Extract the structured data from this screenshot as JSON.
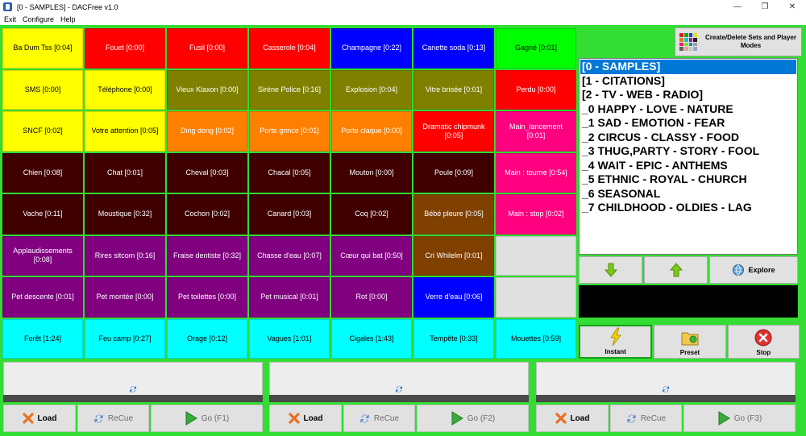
{
  "window": {
    "title": "[0 - SAMPLES] - DACFree v1.0",
    "minimize": "—",
    "maximize": "❐",
    "close": "✕"
  },
  "menu": [
    "Exit",
    "Configure",
    "Help"
  ],
  "colors": {
    "frame": "#33dd33",
    "selected": "#0078d7"
  },
  "pads": [
    [
      {
        "label": "Ba Dum Tss [0:04]",
        "bg": "#ffff00",
        "fg": "#000000"
      },
      {
        "label": "Fouet [0:00]",
        "bg": "#ff0000",
        "fg": "#ffffff"
      },
      {
        "label": "Fusil [0:00]",
        "bg": "#ff0000",
        "fg": "#ffffff"
      },
      {
        "label": "Casserole [0:04]",
        "bg": "#ff0000",
        "fg": "#ffffff"
      },
      {
        "label": "Champagne [0:22]",
        "bg": "#0000ff",
        "fg": "#ffffff"
      },
      {
        "label": "Canette soda [0:13]",
        "bg": "#0000ff",
        "fg": "#ffffff"
      },
      {
        "label": "Gagné [0:01]",
        "bg": "#00ff00",
        "fg": "#000000"
      }
    ],
    [
      {
        "label": "SMS [0:00]",
        "bg": "#ffff00",
        "fg": "#000000"
      },
      {
        "label": "Téléphone [0:00]",
        "bg": "#ffff00",
        "fg": "#000000"
      },
      {
        "label": "Vieux Klaxon [0:00]",
        "bg": "#808000",
        "fg": "#ffffff"
      },
      {
        "label": "Sirène Police [0:16]",
        "bg": "#808000",
        "fg": "#ffffff"
      },
      {
        "label": "Explosion [0:04]",
        "bg": "#808000",
        "fg": "#ffffff"
      },
      {
        "label": "Vitre brisée [0:01]",
        "bg": "#808000",
        "fg": "#ffffff"
      },
      {
        "label": "Perdu [0:00]",
        "bg": "#ff0000",
        "fg": "#ffffff"
      }
    ],
    [
      {
        "label": "SNCF [0:02]",
        "bg": "#ffff00",
        "fg": "#000000"
      },
      {
        "label": "Votre attention [0:05]",
        "bg": "#ffff00",
        "fg": "#000000"
      },
      {
        "label": "Ding dong [0:02]",
        "bg": "#ff8000",
        "fg": "#ffffff"
      },
      {
        "label": "Porte grince [0:01]",
        "bg": "#ff8000",
        "fg": "#ffffff"
      },
      {
        "label": "Porte claque [0:00]",
        "bg": "#ff8000",
        "fg": "#ffffff"
      },
      {
        "label": "Dramatic chipmunk [0:05]",
        "bg": "#ff0000",
        "fg": "#ffffff"
      },
      {
        "label": "Main_lancement [0:01]",
        "bg": "#ff0080",
        "fg": "#ffffff"
      }
    ],
    [
      {
        "label": "Chien [0:08]",
        "bg": "#400000",
        "fg": "#ffffff"
      },
      {
        "label": "Chat [0:01]",
        "bg": "#400000",
        "fg": "#ffffff"
      },
      {
        "label": "Cheval [0:03]",
        "bg": "#400000",
        "fg": "#ffffff"
      },
      {
        "label": "Chacal [0:05]",
        "bg": "#400000",
        "fg": "#ffffff"
      },
      {
        "label": "Mouton [0:00]",
        "bg": "#400000",
        "fg": "#ffffff"
      },
      {
        "label": "Poule [0:09]",
        "bg": "#400000",
        "fg": "#ffffff"
      },
      {
        "label": "Main : tourne [0:54]",
        "bg": "#ff0080",
        "fg": "#ffffff"
      }
    ],
    [
      {
        "label": "Vache [0:11]",
        "bg": "#400000",
        "fg": "#ffffff"
      },
      {
        "label": "Moustique [0:32]",
        "bg": "#400000",
        "fg": "#ffffff"
      },
      {
        "label": "Cochon [0:02]",
        "bg": "#400000",
        "fg": "#ffffff"
      },
      {
        "label": "Canard [0:03]",
        "bg": "#400000",
        "fg": "#ffffff"
      },
      {
        "label": "Coq [0:02]",
        "bg": "#400000",
        "fg": "#ffffff"
      },
      {
        "label": "Bébé pleure [0:05]",
        "bg": "#804000",
        "fg": "#ffffff"
      },
      {
        "label": "Main : stop [0:02]",
        "bg": "#ff0080",
        "fg": "#ffffff"
      }
    ],
    [
      {
        "label": "Applaudissements [0:08]",
        "bg": "#800080",
        "fg": "#ffffff"
      },
      {
        "label": "Rires sitcom [0:16]",
        "bg": "#800080",
        "fg": "#ffffff"
      },
      {
        "label": "Fraise dentiste [0:32]",
        "bg": "#800080",
        "fg": "#ffffff"
      },
      {
        "label": "Chasse d'eau [0:07]",
        "bg": "#800080",
        "fg": "#ffffff"
      },
      {
        "label": "Cœur qui bat [0:50]",
        "bg": "#800080",
        "fg": "#ffffff"
      },
      {
        "label": "Cri Whilelm [0:01]",
        "bg": "#804000",
        "fg": "#ffffff"
      },
      {
        "label": "",
        "bg": "#e0e0e0",
        "fg": "#000000"
      }
    ],
    [
      {
        "label": "Pet descente [0:01]",
        "bg": "#800080",
        "fg": "#ffffff"
      },
      {
        "label": "Pet montée [0:00]",
        "bg": "#800080",
        "fg": "#ffffff"
      },
      {
        "label": "Pet toilettes [0:00]",
        "bg": "#800080",
        "fg": "#ffffff"
      },
      {
        "label": "Pet musical [0:01]",
        "bg": "#800080",
        "fg": "#ffffff"
      },
      {
        "label": "Rot [0:00]",
        "bg": "#800080",
        "fg": "#ffffff"
      },
      {
        "label": "Verre d'eau [0:06]",
        "bg": "#0000ff",
        "fg": "#ffffff"
      },
      {
        "label": "",
        "bg": "#e0e0e0",
        "fg": "#000000"
      }
    ],
    [
      {
        "label": "Forêt [1:24]",
        "bg": "#00ffff",
        "fg": "#000000"
      },
      {
        "label": "Feu camp [0:27]",
        "bg": "#00ffff",
        "fg": "#000000"
      },
      {
        "label": "Orage [0:12]",
        "bg": "#00ffff",
        "fg": "#000000"
      },
      {
        "label": "Vagues [1:01]",
        "bg": "#00ffff",
        "fg": "#000000"
      },
      {
        "label": "Cigales [1:43]",
        "bg": "#00ffff",
        "fg": "#000000"
      },
      {
        "label": "Tempête [0:33]",
        "bg": "#00ffff",
        "fg": "#000000"
      },
      {
        "label": "Mouettes [0:59]",
        "bg": "#00ffff",
        "fg": "#000000"
      }
    ]
  ],
  "create_button": "Create/Delete Sets and Player Modes",
  "sets": [
    "[0 - SAMPLES]",
    "[1 - CITATIONS]",
    "[2 - TV - WEB - RADIO]",
    "_0 HAPPY - LOVE - NATURE",
    "_1 SAD - EMOTION - FEAR",
    "_2 CIRCUS - CLASSY - FOOD",
    "_3 THUG,PARTY - STORY - FOOL",
    "_4 WAIT - EPIC - ANTHEMS",
    "_5 ETHNIC - ROYAL - CHURCH",
    "_6 SEASONAL",
    "_7 CHILDHOOD - OLDIES - LAG"
  ],
  "selected_set": 0,
  "explore_label": "Explore",
  "controls": {
    "instant": "Instant",
    "preset": "Preset",
    "stop": "Stop"
  },
  "players": [
    {
      "load": "Load",
      "recue": "ReCue",
      "go": "Go (F1)"
    },
    {
      "load": "Load",
      "recue": "ReCue",
      "go": "Go (F2)"
    },
    {
      "load": "Load",
      "recue": "ReCue",
      "go": "Go (F3)"
    }
  ]
}
